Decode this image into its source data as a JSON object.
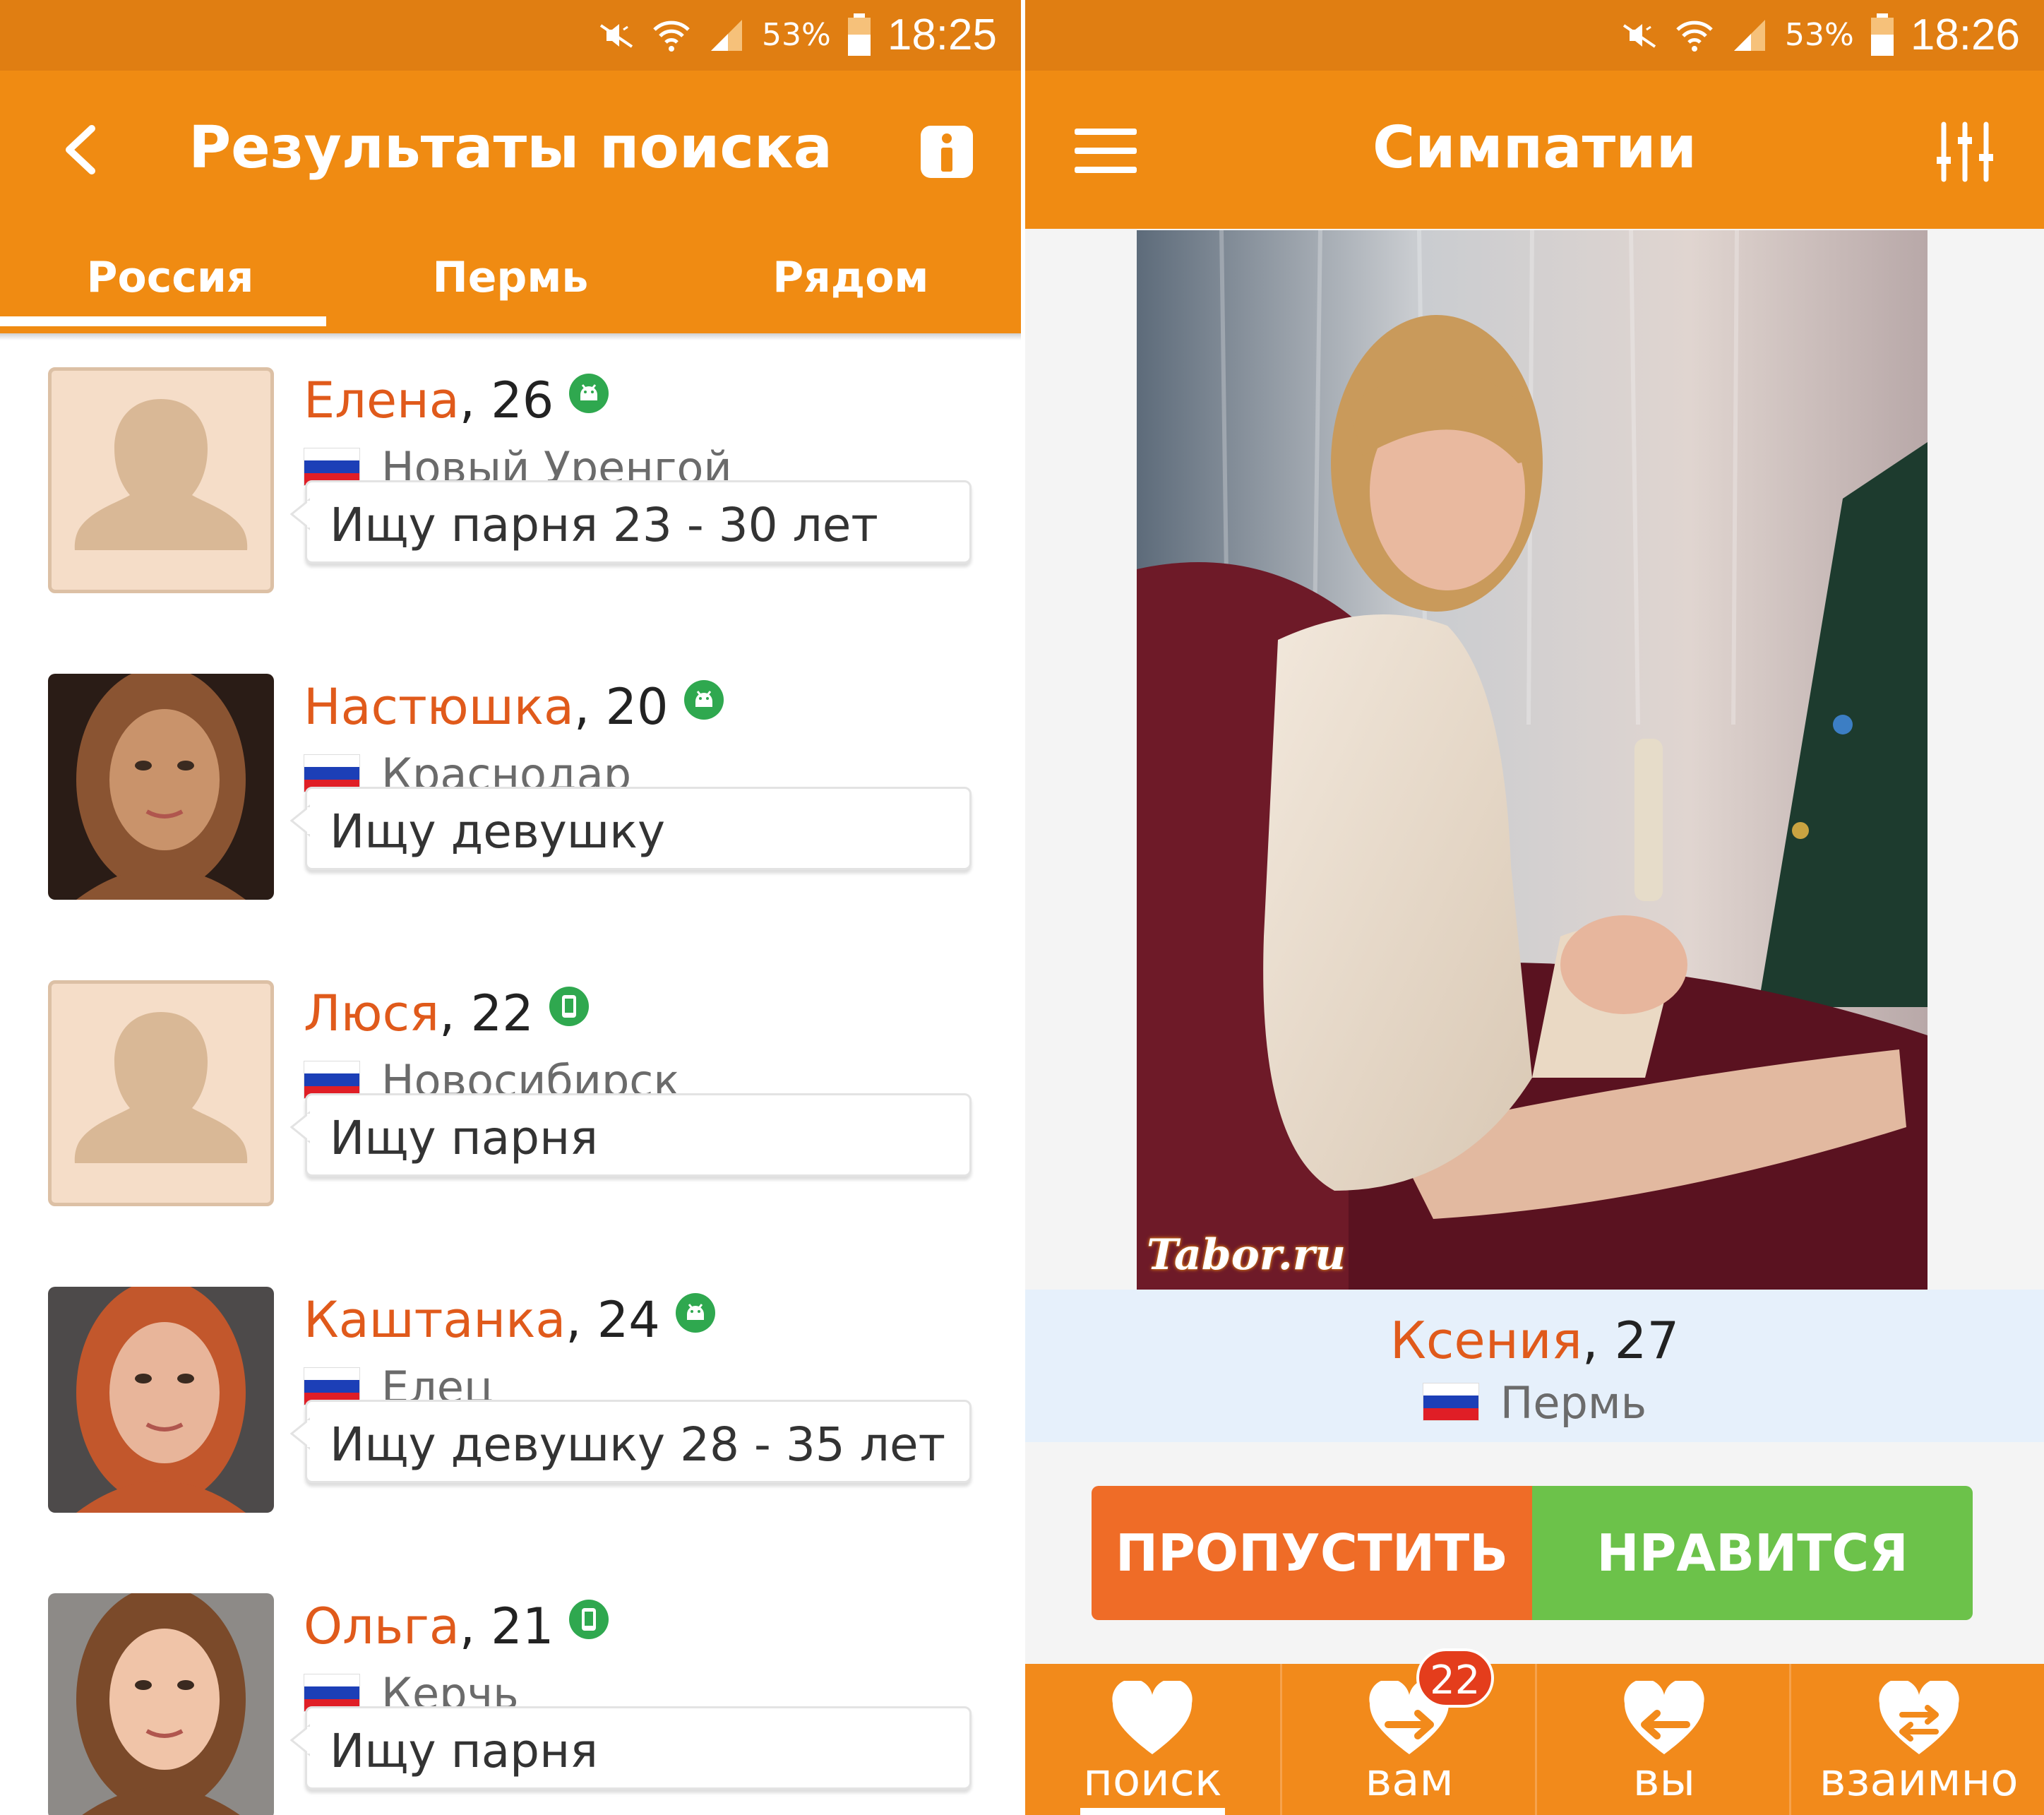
{
  "left_screen": {
    "status": {
      "battery": "53%",
      "time": "18:25"
    },
    "title": "Результаты поиска",
    "tabs": [
      {
        "label": "Россия"
      },
      {
        "label": "Пермь"
      },
      {
        "label": "Рядом"
      }
    ],
    "active_tab": "Россия",
    "results": [
      {
        "name": "Елена",
        "age": ", 26",
        "city": "Новый Уренгой",
        "seeking": "Ищу парня 23 - 30 лет",
        "device": "android-icon",
        "photo": "placeholder"
      },
      {
        "name": "Настюшка",
        "age": ", 20",
        "city": "Краснодар",
        "seeking": "Ищу девушку",
        "device": "android-icon",
        "photo": "photo"
      },
      {
        "name": "Люся",
        "age": ", 22",
        "city": "Новосибирск",
        "seeking": "Ищу парня",
        "device": "mobile-icon",
        "photo": "placeholder"
      },
      {
        "name": "Каштанка",
        "age": ", 24",
        "city": "Елец",
        "seeking": "Ищу девушку 28 - 35 лет",
        "device": "android-icon",
        "photo": "photo"
      },
      {
        "name": "Ольга",
        "age": ", 21",
        "city": "Керчь",
        "seeking": "Ищу парня",
        "device": "mobile-icon",
        "photo": "photo"
      }
    ]
  },
  "right_screen": {
    "status": {
      "battery": "53%",
      "time": "18:26"
    },
    "title": "Симпатии",
    "photo_watermark": "Tabor.ru",
    "profile": {
      "name": "Ксения",
      "age": ", 27",
      "city": "Пермь"
    },
    "buttons": {
      "skip": "ПРОПУСТИТЬ",
      "like": "НРАВИТСЯ"
    },
    "nav": [
      {
        "label": "поиск",
        "icon": "heart-icon",
        "active": true
      },
      {
        "label": "вам",
        "icon": "heart-incoming-icon",
        "badge": "22"
      },
      {
        "label": "вы",
        "icon": "heart-outgoing-icon"
      },
      {
        "label": "взаимно",
        "icon": "heart-mutual-icon"
      }
    ]
  },
  "colors": {
    "status_bar": "#e07e12",
    "app_bar": "#f08b12",
    "name": "#e05a1b",
    "skip": "#ef6c27",
    "like": "#6cc24a",
    "online": "#2fa84f"
  }
}
